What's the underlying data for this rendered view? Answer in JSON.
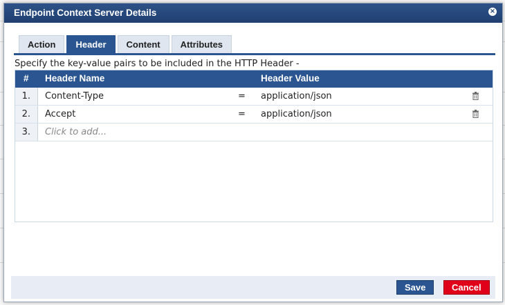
{
  "dialog": {
    "title": "Endpoint Context Server Details",
    "close_icon": "close-icon"
  },
  "tabs": [
    {
      "label": "Action",
      "active": false
    },
    {
      "label": "Header",
      "active": true
    },
    {
      "label": "Content",
      "active": false
    },
    {
      "label": "Attributes",
      "active": false
    }
  ],
  "instructions": "Specify the key-value pairs to be included in the HTTP Header -",
  "table": {
    "columns": {
      "num": "#",
      "name": "Header Name",
      "value": "Header Value"
    },
    "rows": [
      {
        "num": "1.",
        "name": "Content-Type",
        "eq": "=",
        "value": "application/json"
      },
      {
        "num": "2.",
        "name": "Accept",
        "eq": "=",
        "value": "application/json"
      }
    ],
    "add_row": {
      "num": "3.",
      "placeholder": "Click to add..."
    }
  },
  "buttons": {
    "save": "Save",
    "cancel": "Cancel"
  },
  "colors": {
    "header_blue": "#2a5590",
    "cancel_red": "#e0001a"
  }
}
